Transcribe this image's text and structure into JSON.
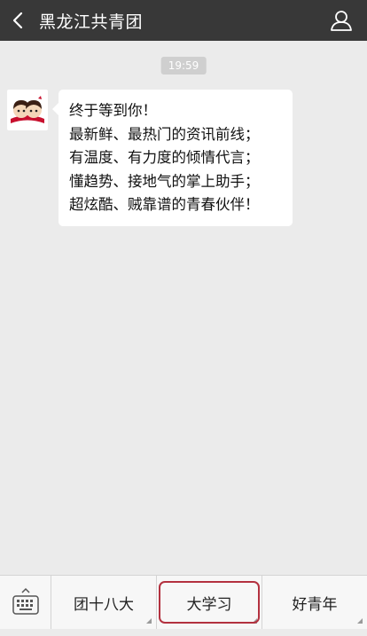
{
  "header": {
    "title": "黑龙江共青团",
    "back_icon": "chevron-left-icon",
    "profile_icon": "person-icon"
  },
  "chat": {
    "timestamp": "19:59",
    "message": {
      "lines": [
        "终于等到你！",
        "最新鲜、最热门的资讯前线；",
        "有温度、有力度的倾情代言；",
        "懂趋势、接地气的掌上助手；",
        "超炫酷、贼靠谱的青春伙伴！"
      ]
    }
  },
  "footer": {
    "keyboard_icon": "keyboard-icon",
    "menus": [
      {
        "label": "团十八大"
      },
      {
        "label": "大学习"
      },
      {
        "label": "好青年"
      }
    ]
  },
  "colors": {
    "header_bg": "#383838",
    "page_bg": "#ebebeb",
    "active_border": "#b3313f"
  }
}
